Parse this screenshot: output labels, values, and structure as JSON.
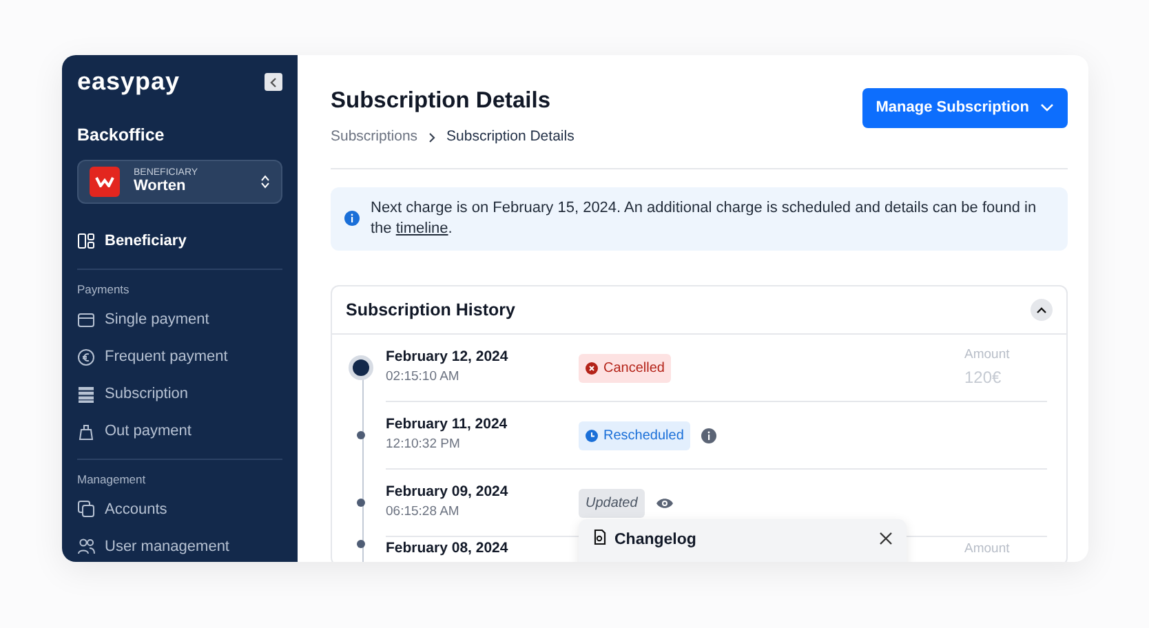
{
  "sidebar": {
    "logo": "easypay",
    "title": "Backoffice",
    "beneficiary_selector": {
      "label": "BENEFICIARY",
      "value": "Worten"
    },
    "items": [
      {
        "label": "Beneficiary",
        "kind": "grid",
        "selected": true
      }
    ],
    "sections": [
      {
        "title": "Payments",
        "items": [
          {
            "label": "Single payment",
            "kind": "card",
            "selected": false
          },
          {
            "label": "Frequent payment",
            "kind": "euro",
            "selected": false
          },
          {
            "label": "Subscription",
            "kind": "stack",
            "selected": false
          },
          {
            "label": "Out payment",
            "kind": "bag",
            "selected": false
          }
        ]
      },
      {
        "title": "Management",
        "items": [
          {
            "label": "Accounts",
            "kind": "copy",
            "selected": false
          },
          {
            "label": "User management",
            "kind": "users",
            "selected": false
          }
        ]
      }
    ]
  },
  "header": {
    "title": "Subscription Details",
    "breadcrumb": [
      "Subscriptions",
      "Subscription Details"
    ],
    "button": "Manage Subscription"
  },
  "alert": {
    "text": "Next charge is on February 15, 2024. An additional charge is scheduled and details can be found in the ",
    "link": "timeline",
    "end": "."
  },
  "history": {
    "title": "Subscription History",
    "expanded": true,
    "events": [
      {
        "date": "February 12, 2024",
        "time": "02:15:10 AM",
        "status": "Cancelled",
        "kind": "cancelled",
        "amount_label": "Amount",
        "amount": "120€",
        "current": true
      },
      {
        "date": "February 11, 2024",
        "time": "12:10:32 PM",
        "status": "Rescheduled",
        "kind": "rescheduled",
        "current": false
      },
      {
        "date": "February 09, 2024",
        "time": "06:15:28 AM",
        "status": "Updated",
        "kind": "updated",
        "current": false
      },
      {
        "date": "February 08, 2024",
        "amount_label": "Amount",
        "current": false
      }
    ]
  },
  "popover": {
    "title": "Changelog"
  }
}
